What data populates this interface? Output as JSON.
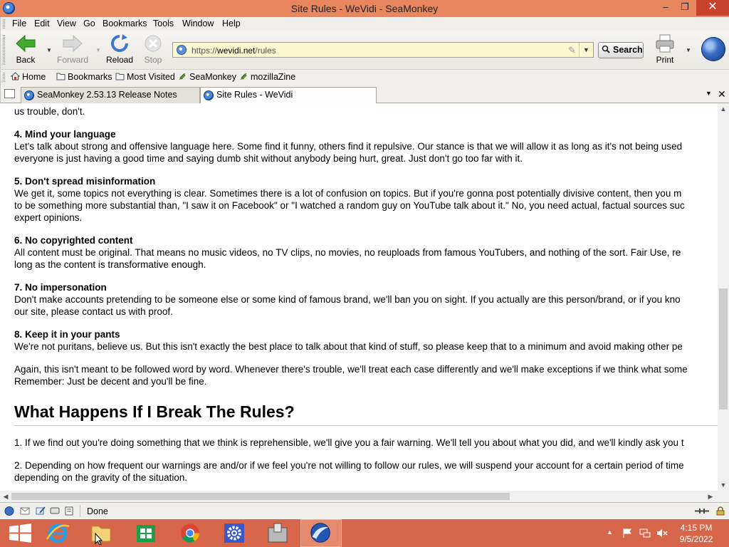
{
  "window": {
    "title": "Site Rules - WeVidi - SeaMonkey",
    "min": "–",
    "max": "❐",
    "close": "✕"
  },
  "menu": [
    "File",
    "Edit",
    "View",
    "Go",
    "Bookmarks",
    "Tools",
    "Window",
    "Help"
  ],
  "toolbar": {
    "back": "Back",
    "forward": "Forward",
    "reload": "Reload",
    "stop": "Stop",
    "url_scheme": "https://",
    "url_host": "wevidi.net",
    "url_path": "/rules",
    "search": "Search",
    "print": "Print"
  },
  "personal_bar": [
    "Home",
    "Bookmarks",
    "Most Visited",
    "SeaMonkey",
    "mozillaZine"
  ],
  "tabs": [
    {
      "label": "SeaMonkey 2.53.13 Release Notes"
    },
    {
      "label": "Site Rules - WeVidi"
    }
  ],
  "page": {
    "intro_tail": "us trouble, don't.",
    "rules": [
      {
        "title": "4. Mind your language",
        "lines": [
          "Let's talk about strong and offensive language here. Some find it funny, others find it repulsive. Our stance is that we will allow it as long as it's not being used",
          "everyone is just having a good time and saying dumb shit without anybody being hurt, great. Just don't go too far with it."
        ]
      },
      {
        "title": "5. Don't spread misinformation",
        "lines": [
          "We get it, some topics not everything is clear. Sometimes there is a lot of confusion on topics. But if you're gonna post potentially divisive content, then you m",
          "to be something more substantial than, \"I saw it on Facebook\" or \"I watched a random guy on YouTube talk about it.\" No, you need actual, factual sources suc",
          "expert opinions."
        ]
      },
      {
        "title": "6. No copyrighted content",
        "lines": [
          "All content must be original. That means no music videos, no TV clips, no movies, no reuploads from famous YouTubers, and nothing of the sort. Fair Use, re",
          "long as the content is transformative enough."
        ]
      },
      {
        "title": "7. No impersonation",
        "lines": [
          "Don't make accounts pretending to be someone else or some kind of famous brand, we'll ban you on sight. If you actually are this person/brand, or if you kno",
          "our site, please contact us with proof."
        ]
      },
      {
        "title": "8. Keep it in your pants",
        "lines": [
          "We're not puritans, believe us. But this isn't exactly the best place to talk about that kind of stuff, so please keep that to a minimum and avoid making other pe"
        ]
      }
    ],
    "closing": [
      "Again, this isn't meant to be followed word by word. Whenever there's trouble, we'll treat each case differently and we'll make exceptions if we think what some",
      "Remember: Just be decent and you'll be fine."
    ],
    "heading": "What Happens If I Break The Rules?",
    "consequences": [
      [
        "1. If we find out you're doing something that we think is reprehensible, we'll give you a fair warning. We'll tell you about what you did, and we'll kindly ask you t"
      ],
      [
        "2. Depending on how frequent our warnings are and/or if we feel you're not willing to follow our rules, we will suspend your account for a certain period of time",
        "depending on the gravity of the situation."
      ]
    ]
  },
  "status": {
    "text": "Done"
  },
  "clock": {
    "time": "4:15 PM",
    "date": "9/5/2022"
  }
}
